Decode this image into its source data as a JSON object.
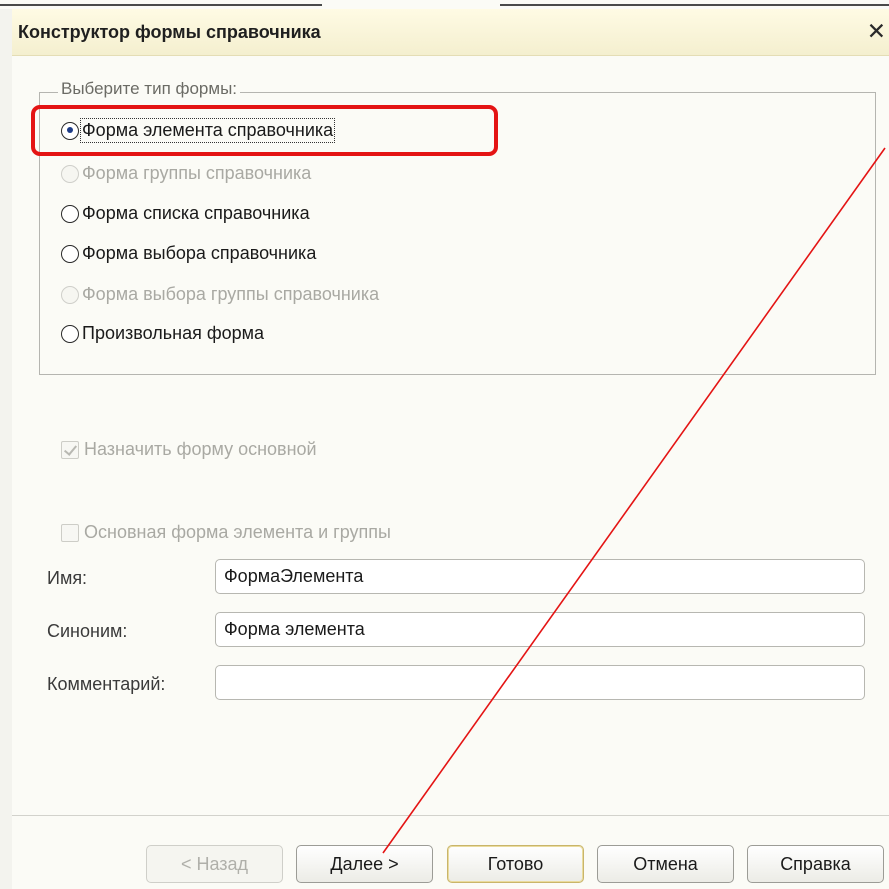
{
  "window": {
    "title": "Конструктор формы справочника",
    "close_glyph": "✕"
  },
  "form_type_group": {
    "legend": "Выберите тип формы:",
    "options": [
      {
        "label": "Форма элемента справочника",
        "selected": true,
        "disabled": false
      },
      {
        "label": "Форма группы справочника",
        "selected": false,
        "disabled": true
      },
      {
        "label": "Форма списка справочника",
        "selected": false,
        "disabled": false
      },
      {
        "label": "Форма выбора справочника",
        "selected": false,
        "disabled": false
      },
      {
        "label": "Форма выбора группы справочника",
        "selected": false,
        "disabled": true
      },
      {
        "label": "Произвольная форма",
        "selected": false,
        "disabled": false
      }
    ]
  },
  "options": {
    "set_main": {
      "label": "Назначить форму основной",
      "checked": true,
      "disabled": true
    },
    "main_element_group": {
      "label": "Основная форма элемента и группы",
      "checked": false,
      "disabled": true
    }
  },
  "fields": {
    "name": {
      "label": "Имя:",
      "value": "ФормаЭлемента"
    },
    "synonym": {
      "label": "Синоним:",
      "value": "Форма элемента"
    },
    "comment": {
      "label": "Комментарий:",
      "value": ""
    }
  },
  "buttons": {
    "back": "< Назад",
    "next": "Далее >",
    "finish": "Готово",
    "cancel": "Отмена",
    "help": "Справка"
  },
  "annotations": {
    "highlight_color": "#e41414",
    "arrow_color": "#e41414"
  }
}
